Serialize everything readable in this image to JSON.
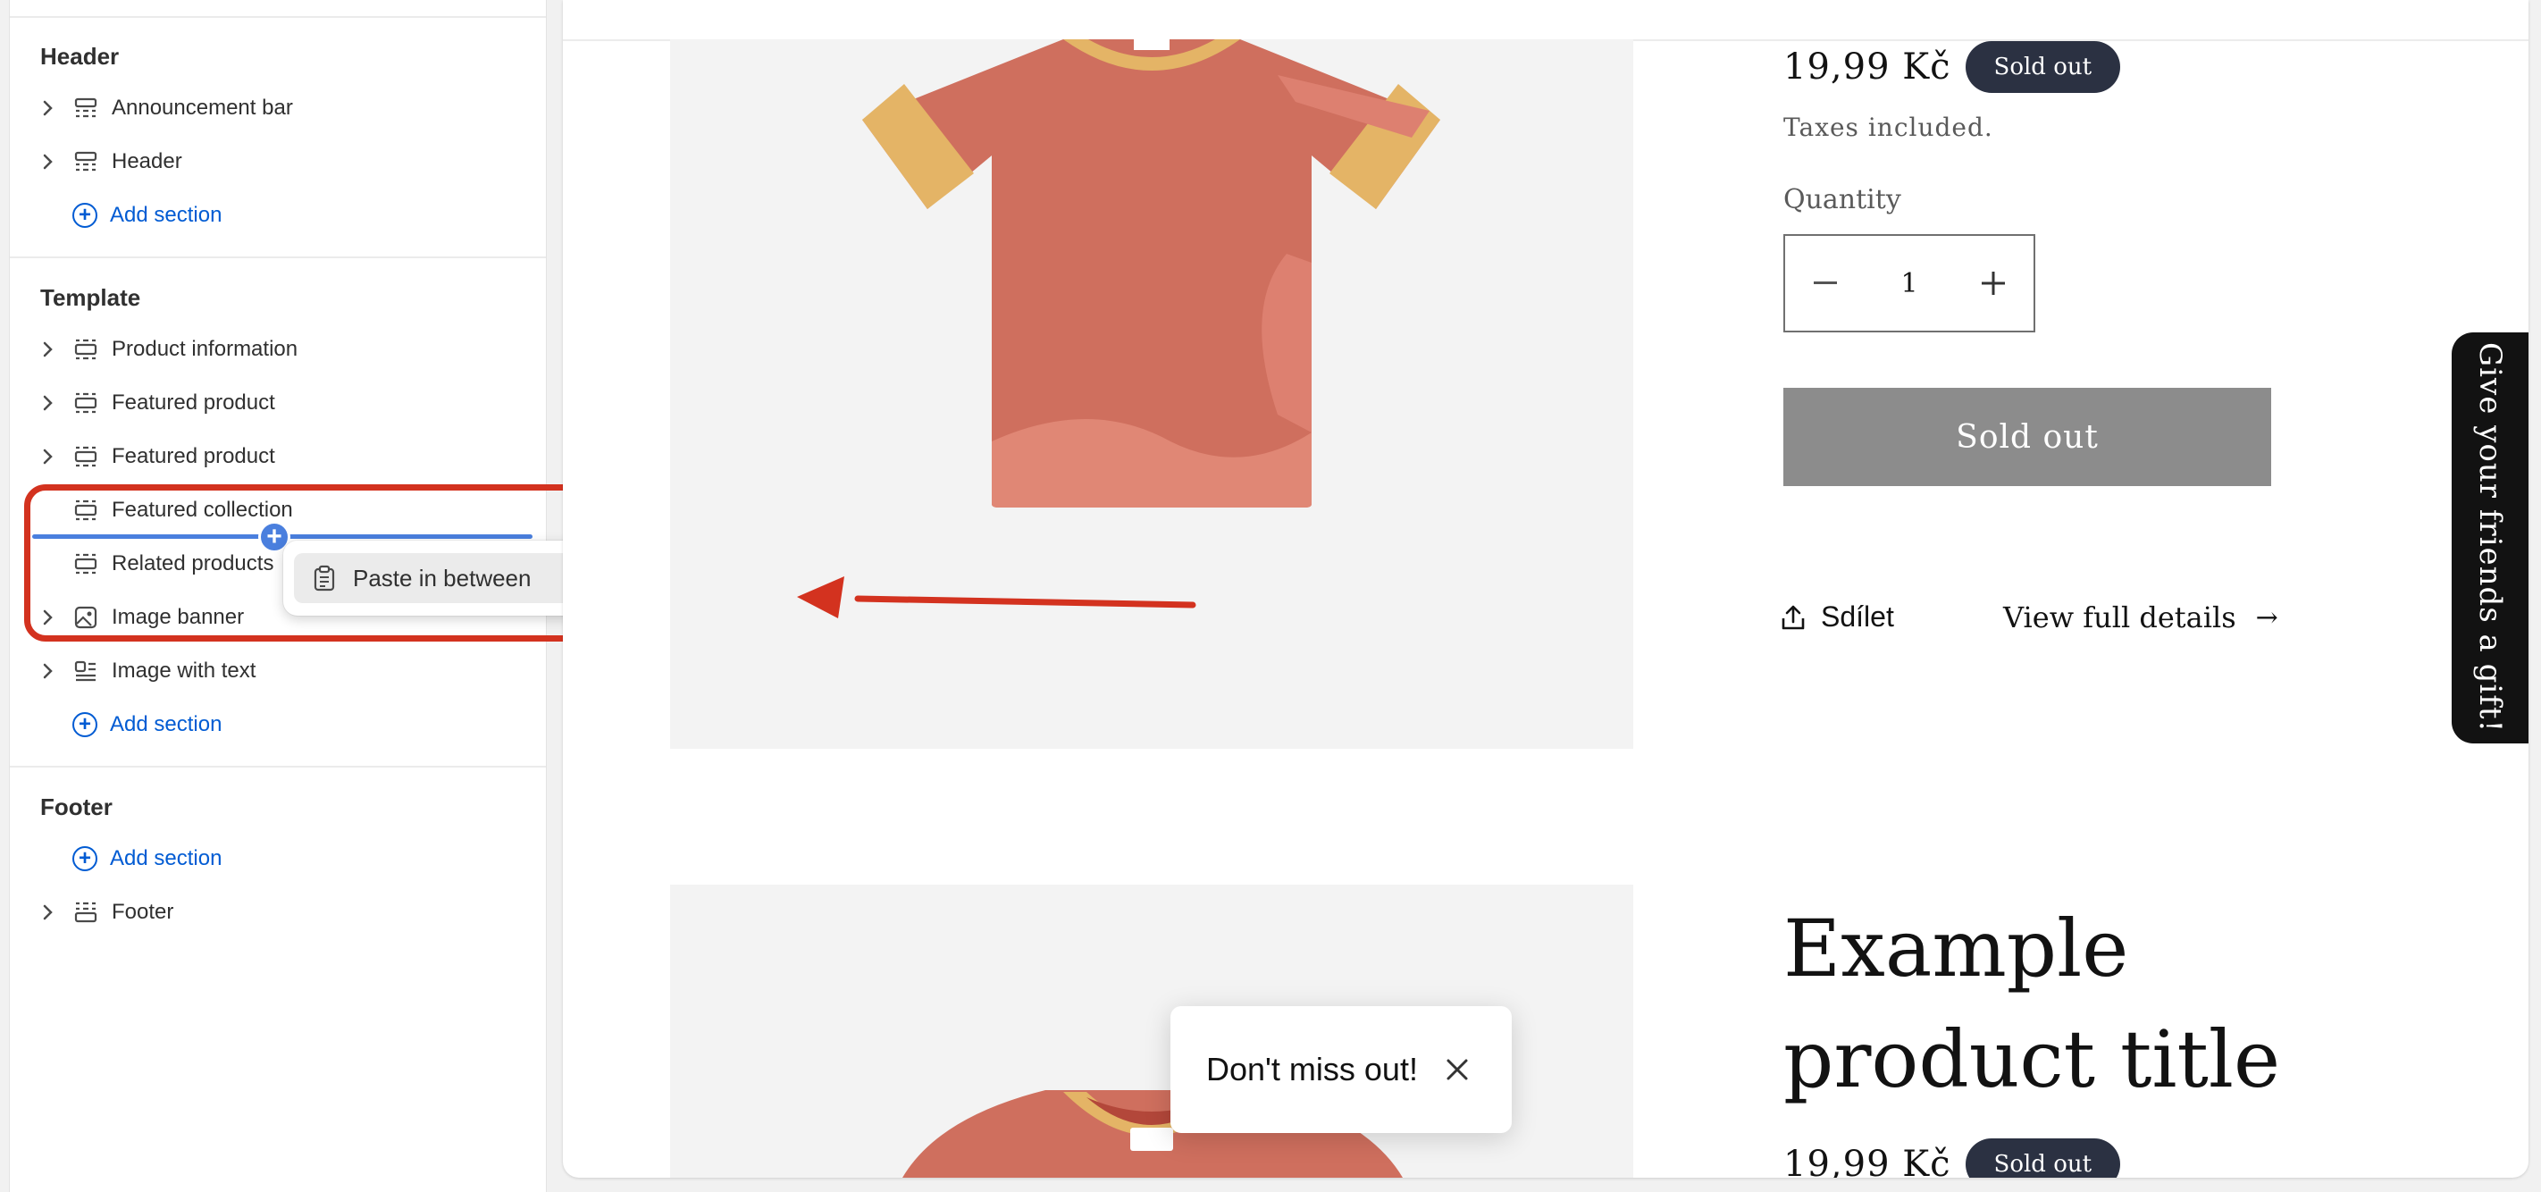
{
  "sidebar": {
    "header_group": {
      "title": "Header",
      "items": [
        {
          "label": "Announcement bar"
        },
        {
          "label": "Header"
        }
      ],
      "add_section": "Add section"
    },
    "template_group": {
      "title": "Template",
      "items": [
        {
          "label": "Product information"
        },
        {
          "label": "Featured product"
        },
        {
          "label": "Featured product"
        },
        {
          "label": "Featured collection"
        },
        {
          "label": "Related products"
        },
        {
          "label": "Image banner"
        },
        {
          "label": "Image with text"
        }
      ],
      "add_section": "Add section"
    },
    "footer_group": {
      "title": "Footer",
      "add_section": "Add section",
      "items": [
        {
          "label": "Footer"
        }
      ]
    }
  },
  "context_menu": {
    "paste_label": "Paste in between"
  },
  "preview": {
    "price": "19,99 Kč",
    "badge": "Sold out",
    "taxes": "Taxes included.",
    "quantity_label": "Quantity",
    "quantity_value": "1",
    "sold_out_button": "Sold out",
    "share_label": "Sdílet",
    "view_details": "View full details",
    "product_title": "Example product title",
    "price2": "19,99 Kč",
    "badge2": "Sold out",
    "gift_tab": "Give your friends a gift!",
    "toast_text": "Don't miss out!"
  },
  "colors": {
    "accent_blue": "#005bd3",
    "insert_line": "#4a7fde",
    "annotation_red": "#d3321f",
    "shirt": "#cf6f5e",
    "shirt_trim": "#e4b466",
    "badge_bg": "#2b3142",
    "sold_button": "#8c8c8c"
  }
}
